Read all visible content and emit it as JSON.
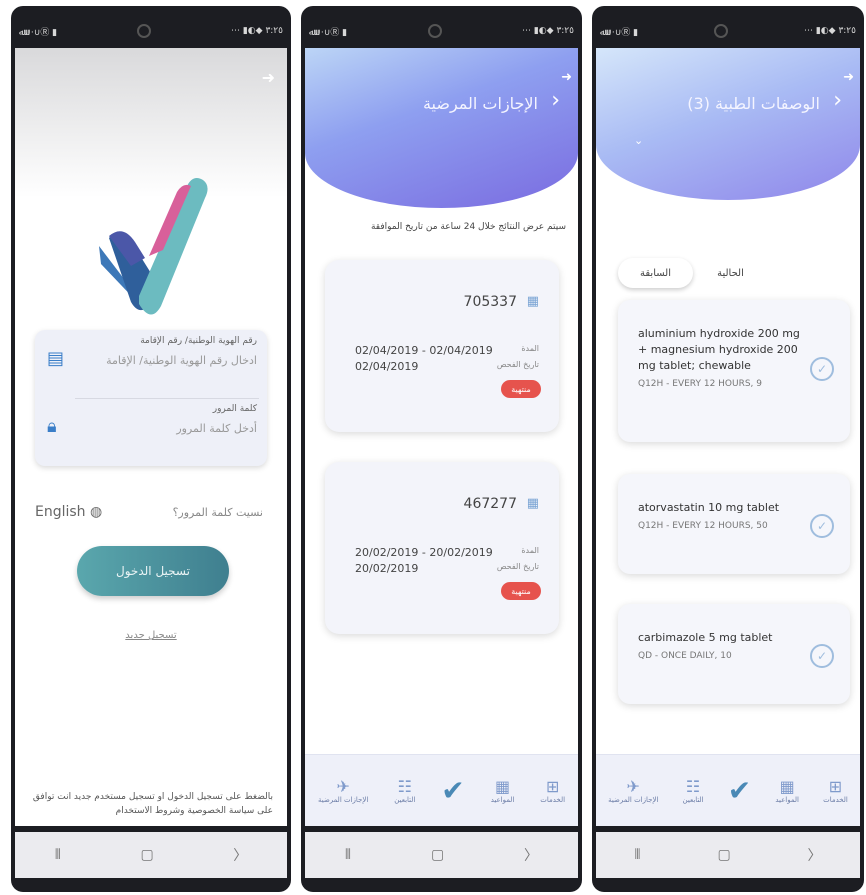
{
  "status_bar": {
    "left": "ﷲ∪·∪Ⓡ ▮",
    "right": "⋯ ▮◐◆ ٣:٢٥"
  },
  "screen1": {
    "id_label": "رقم الهوية الوطنية/ رقم الإقامة",
    "id_placeholder": "ادخال رقم الهوية الوطنية/ الإقامة",
    "password_label": "كلمة المرور",
    "password_placeholder": "أدخل كلمة المرور",
    "language": "English",
    "forgot": "نسيت كلمة المرور؟",
    "login": "تسجيل الدخول",
    "register": "تسجيل جديد",
    "terms": "بالضغط على تسجيل الدخول او تسجيل مستخدم جديد انت توافق على سياسة الخصوصية وشروط الاستخدام"
  },
  "screen2": {
    "title": "الإجازات المرضية",
    "note": "سيتم عرض النتائج خلال 24 ساعة من تاريخ الموافقة",
    "leaves": [
      {
        "number": "705337",
        "range": "02/04/2019 - 02/04/2019",
        "date2": "02/04/2019",
        "label1": "المدة",
        "label2": "تاريخ الفحص",
        "status": "منتهية"
      },
      {
        "number": "467277",
        "range": "20/02/2019 - 20/02/2019",
        "date2": "20/02/2019",
        "label1": "المدة",
        "label2": "تاريخ الفحص",
        "status": "منتهية"
      }
    ]
  },
  "screen3": {
    "title": "(3) الوصفات الطبية",
    "tab_previous": "السابقة",
    "tab_current": "الحالية",
    "prescriptions": [
      {
        "name": "aluminium hydroxide 200 mg + magnesium hydroxide 200 mg tablet; chewable",
        "dose": "Q12H - EVERY 12 HOURS, 9"
      },
      {
        "name": "atorvastatin 10 mg tablet",
        "dose": "Q12H - EVERY 12 HOURS, 50"
      },
      {
        "name": "carbimazole 5 mg tablet",
        "dose": "QD - ONCE DAILY, 10"
      }
    ]
  },
  "tabbar": {
    "services": "الخدمات",
    "appointments": "المواعيد",
    "family": "التابعين",
    "sick_leave": "الإجازات المرضية"
  }
}
